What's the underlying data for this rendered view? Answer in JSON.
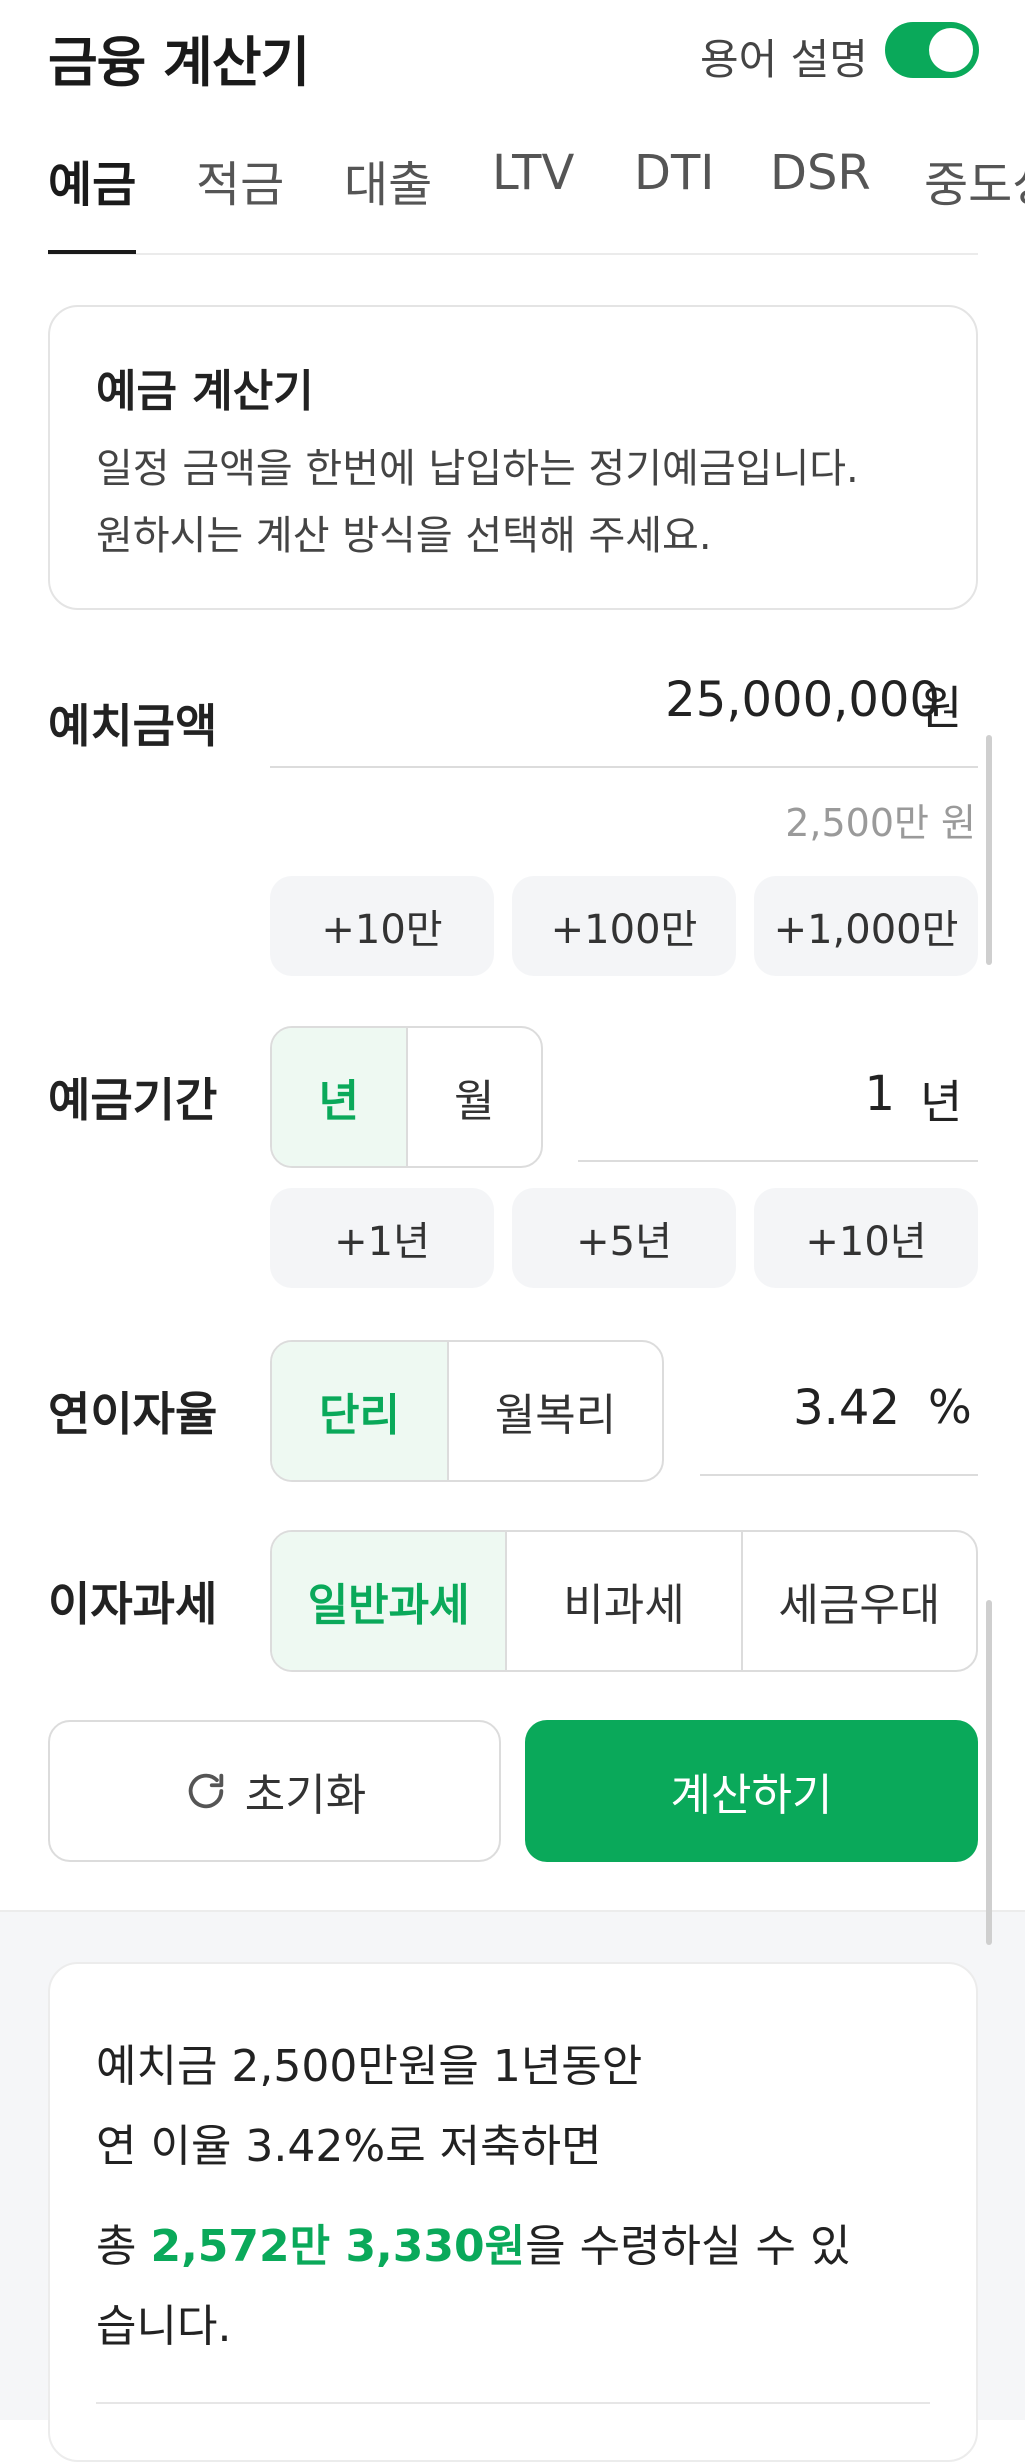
{
  "header": {
    "title": "금융 계산기",
    "term_toggle_label": "용어 설명",
    "term_toggle_on": true
  },
  "tabs": [
    {
      "label": "예금",
      "active": true
    },
    {
      "label": "적금",
      "active": false
    },
    {
      "label": "대출",
      "active": false
    },
    {
      "label": "LTV",
      "active": false
    },
    {
      "label": "DTI",
      "active": false
    },
    {
      "label": "DSR",
      "active": false
    },
    {
      "label": "중도상",
      "active": false
    }
  ],
  "info": {
    "title": "예금 계산기",
    "line1": "일정 금액을 한번에 납입하는 정기예금입니다.",
    "line2": "원하시는 계산 방식을 선택해 주세요."
  },
  "deposit": {
    "label": "예치금액",
    "value": "25,000,000",
    "unit": "원",
    "sub": "2,500만 원",
    "chips": [
      "+10만",
      "+100만",
      "+1,000만"
    ]
  },
  "period": {
    "label": "예금기간",
    "seg": [
      "년",
      "월"
    ],
    "value": "1",
    "unit": "년",
    "chips": [
      "+1년",
      "+5년",
      "+10년"
    ]
  },
  "rate": {
    "label": "연이자율",
    "seg": [
      "단리",
      "월복리"
    ],
    "value": "3.42",
    "unit": "%"
  },
  "tax": {
    "label": "이자과세",
    "seg": [
      "일반과세",
      "비과세",
      "세금우대"
    ]
  },
  "buttons": {
    "reset": "초기화",
    "calculate": "계산하기"
  },
  "result": {
    "line1": "예치금 2,500만원을 1년동안",
    "line2": "연 이율 3.42%로 저축하면",
    "line3_prefix": "총 ",
    "line3_amount": "2,572만 3,330원",
    "line3_suffix": "을 수령하실 수 있",
    "line4": "습니다."
  },
  "colors": {
    "accent": "#0aa95a"
  }
}
